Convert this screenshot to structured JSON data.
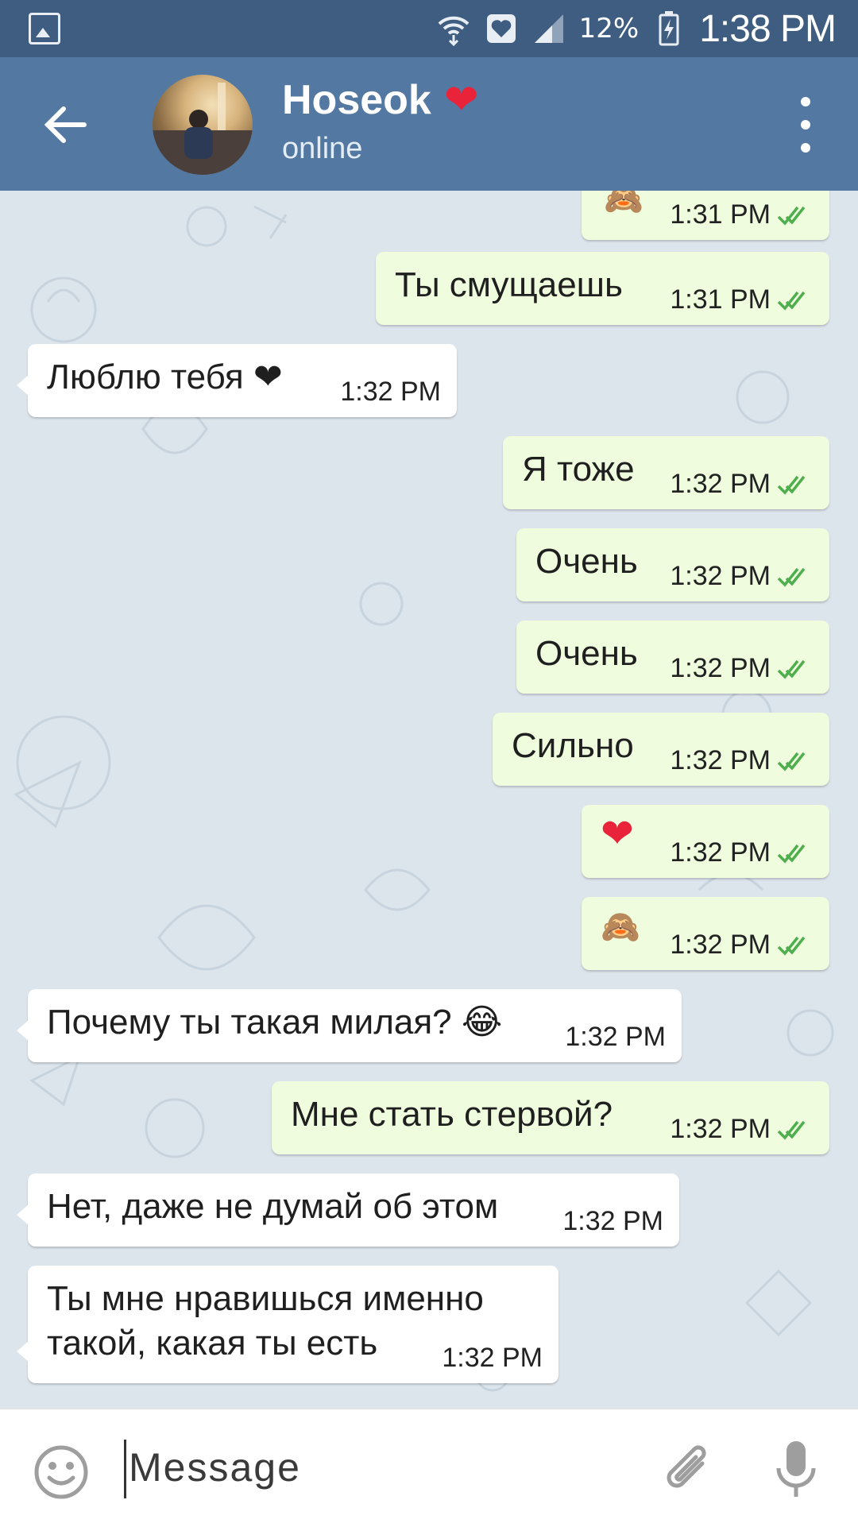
{
  "status_bar": {
    "battery": "12%",
    "time": "1:38 PM",
    "icons": [
      "gallery-icon",
      "wifi-icon",
      "heart-badge-icon",
      "signal-icon",
      "battery-charging-icon"
    ]
  },
  "header": {
    "contact_name": "Hoseok",
    "name_emoji": "❤",
    "status": "online",
    "icons": [
      "back-arrow-icon",
      "avatar",
      "more-vert-icon"
    ]
  },
  "messages": [
    {
      "dir": "out",
      "text": "🙈",
      "time": "1:31 PM",
      "read": true
    },
    {
      "dir": "out",
      "text": "Ты смущаешь",
      "time": "1:31 PM",
      "read": true
    },
    {
      "dir": "in",
      "text": "Люблю тебя ❤",
      "time": "1:32 PM"
    },
    {
      "dir": "out",
      "text": "Я тоже",
      "time": "1:32 PM",
      "read": true
    },
    {
      "dir": "out",
      "text": "Очень",
      "time": "1:32 PM",
      "read": true
    },
    {
      "dir": "out",
      "text": "Очень",
      "time": "1:32 PM",
      "read": true
    },
    {
      "dir": "out",
      "text": "Сильно",
      "time": "1:32 PM",
      "read": true
    },
    {
      "dir": "out",
      "text": "❤",
      "time": "1:32 PM",
      "read": true
    },
    {
      "dir": "out",
      "text": "🙈",
      "time": "1:32 PM",
      "read": true
    },
    {
      "dir": "in",
      "text": "Почему ты такая милая? 😂",
      "time": "1:32 PM"
    },
    {
      "dir": "out",
      "text": "Мне стать стервой?",
      "time": "1:32 PM",
      "read": true
    },
    {
      "dir": "in",
      "text": "Нет, даже не думай об этом",
      "time": "1:32 PM"
    },
    {
      "dir": "in",
      "text_line1": "Ты мне нравишься именно",
      "text_line2": "такой, какая ты есть",
      "time": "1:32 PM"
    }
  ],
  "input": {
    "placeholder": "Message",
    "icons": [
      "smiley-icon",
      "attach-icon",
      "mic-icon"
    ]
  },
  "colors": {
    "status_bar": "#3f5d80",
    "app_bar": "#5379a3",
    "outgoing_bubble": "#effdde",
    "incoming_bubble": "#ffffff",
    "read_check": "#4fae4e",
    "chat_bg": "#dde5ec"
  }
}
